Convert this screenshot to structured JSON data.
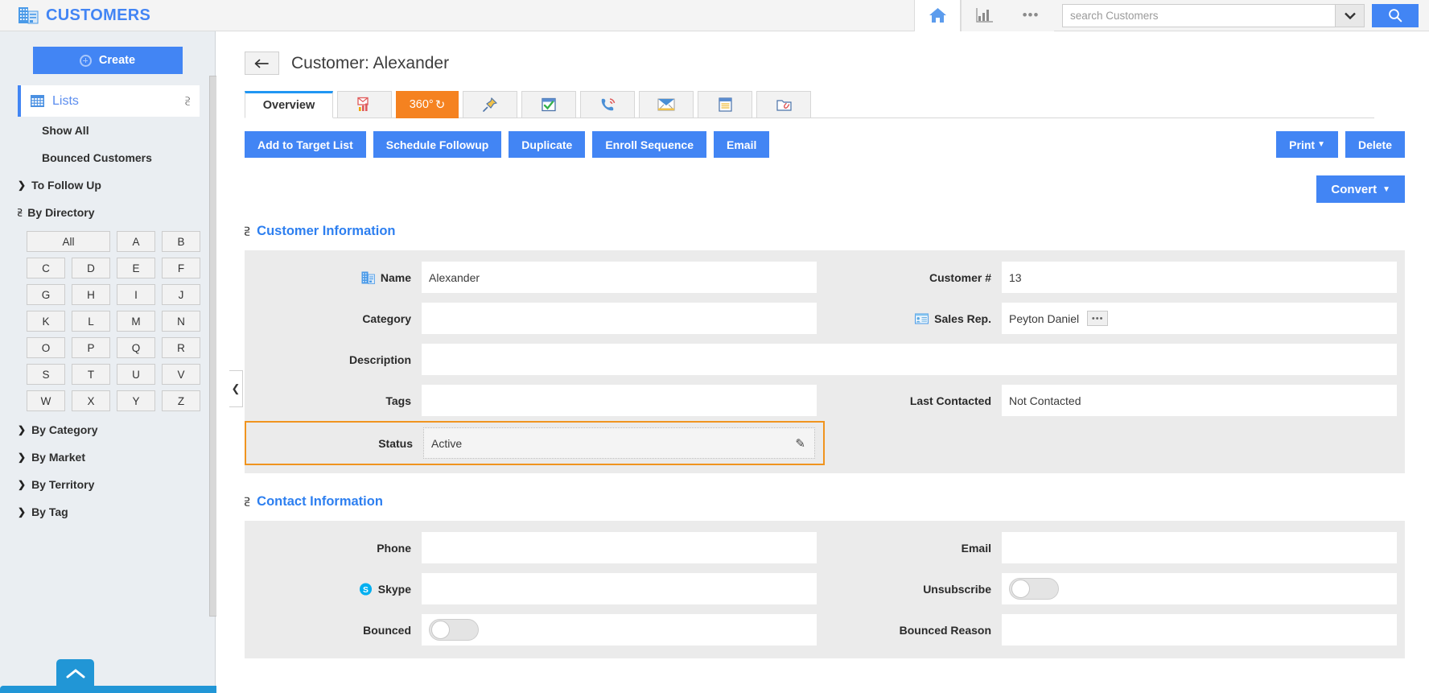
{
  "topbar": {
    "brand": "CUSTOMERS",
    "brand_icon": "building-icon",
    "home_icon": "home-icon",
    "reports_icon": "bar-chart-icon",
    "more_icon": "ellipsis-icon",
    "more_label": "•••",
    "search_placeholder": "search Customers",
    "search_value": "",
    "dropdown_icon": "chevron-down-icon",
    "search_icon": "search-icon",
    "accent_color": "#4285f4"
  },
  "sidebar": {
    "create_label": "Create",
    "lists_label": "Lists",
    "lists_icon": "grid-icon",
    "items": [
      {
        "label": "Show All",
        "type": "link"
      },
      {
        "label": "Bounced Customers",
        "type": "link"
      },
      {
        "label": "To Follow Up",
        "type": "group",
        "expanded": false
      },
      {
        "label": "By Directory",
        "type": "group",
        "expanded": true
      }
    ],
    "alphabet": [
      "All",
      "A",
      "B",
      "C",
      "D",
      "E",
      "F",
      "G",
      "H",
      "I",
      "J",
      "K",
      "L",
      "M",
      "N",
      "O",
      "P",
      "Q",
      "R",
      "S",
      "T",
      "U",
      "V",
      "W",
      "X",
      "Y",
      "Z"
    ],
    "groups_after": [
      {
        "label": "By Category",
        "expanded": false
      },
      {
        "label": "By Market",
        "expanded": false
      },
      {
        "label": "By Territory",
        "expanded": false
      },
      {
        "label": "By Tag",
        "expanded": false
      }
    ],
    "collapse_icon": "chevron-left-icon",
    "scroll_up_icon": "chevron-up-icon"
  },
  "main": {
    "back_icon": "arrow-left-icon",
    "page_title": "Customer: Alexander",
    "tabs": [
      {
        "label": "Overview",
        "kind": "text",
        "active": true
      },
      {
        "label": "",
        "kind": "icon",
        "icon": "email-chart-icon",
        "glyph": "📊"
      },
      {
        "label": "360°",
        "kind": "text",
        "active": false,
        "highlight": true
      },
      {
        "label": "",
        "kind": "icon",
        "icon": "pin-icon",
        "glyph": "📌"
      },
      {
        "label": "",
        "kind": "icon",
        "icon": "calendar-check-icon",
        "glyph": "📅"
      },
      {
        "label": "",
        "kind": "icon",
        "icon": "phone-icon",
        "glyph": "📞"
      },
      {
        "label": "",
        "kind": "icon",
        "icon": "envelope-icon",
        "glyph": "✉"
      },
      {
        "label": "",
        "kind": "icon",
        "icon": "notes-icon",
        "glyph": "📒"
      },
      {
        "label": "",
        "kind": "icon",
        "icon": "attachment-folder-icon",
        "glyph": "📎"
      }
    ],
    "actions": [
      "Add to Target List",
      "Schedule Followup",
      "Duplicate",
      "Enroll Sequence",
      "Email"
    ],
    "print_label": "Print",
    "delete_label": "Delete",
    "convert_label": "Convert",
    "customer_information": {
      "title": "Customer Information",
      "expanded": true,
      "left": [
        {
          "label": "Name",
          "value": "Alexander",
          "icon": "building-icon"
        },
        {
          "label": "Category",
          "value": ""
        },
        {
          "label": "Tags",
          "value": ""
        },
        {
          "label": "Status",
          "value": "Active",
          "highlighted": true,
          "edit_icon": "pencil-icon"
        }
      ],
      "description": {
        "label": "Description",
        "value": ""
      },
      "right": [
        {
          "label": "Customer #",
          "value": "13"
        },
        {
          "label": "Sales Rep.",
          "value": "Peyton Daniel",
          "icon": "contact-card-icon",
          "picker": "•••"
        },
        {
          "label": "Last Contacted",
          "value": "Not Contacted"
        }
      ]
    },
    "contact_information": {
      "title": "Contact Information",
      "expanded": true,
      "left": [
        {
          "label": "Phone",
          "value": ""
        },
        {
          "label": "Skype",
          "value": "",
          "icon": "skype-icon"
        },
        {
          "label": "Bounced",
          "value": "",
          "toggle": true,
          "toggle_on": false
        }
      ],
      "right": [
        {
          "label": "Email",
          "value": ""
        },
        {
          "label": "Unsubscribe",
          "value": "",
          "toggle": true,
          "toggle_on": false
        },
        {
          "label": "Bounced Reason",
          "value": ""
        }
      ]
    }
  }
}
